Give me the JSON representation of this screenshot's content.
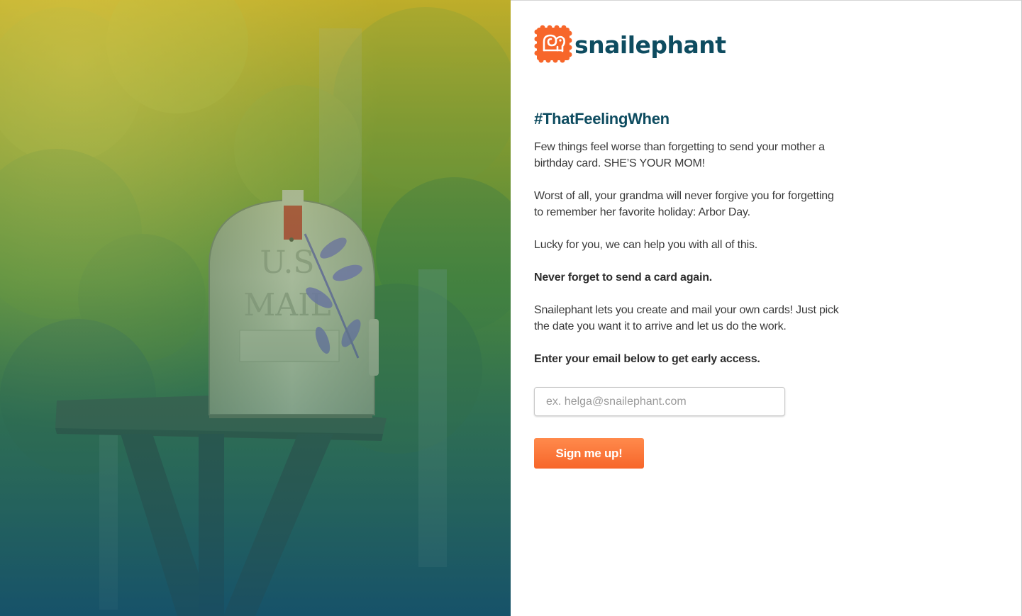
{
  "brand": {
    "name": "snailephant",
    "logo_icon": "elephant-stamp-icon",
    "color": "#0e4c60",
    "accent": "#f7662a"
  },
  "hero": {
    "image": "rural-mailbox-photo",
    "mailbox_lettering": "U.S. MAIL"
  },
  "main": {
    "headline": "#ThatFeelingWhen",
    "paragraphs": [
      "Few things feel worse than forgetting to send your mother a birthday card. SHE’S YOUR MOM!",
      "Worst of all, your grandma will never forgive you for forgetting to remember her favorite holiday: Arbor Day.",
      "Lucky for you, we can help you with all of this.",
      "Never forget to send a card again.",
      "Snailephant lets you create and mail your own cards! Just pick the date you want it to arrive and let us do the work.",
      "Enter your email below to get early access."
    ]
  },
  "signup_form": {
    "email_placeholder": "ex. helga@snailephant.com",
    "email_value": "",
    "submit_label": "Sign me up!"
  }
}
